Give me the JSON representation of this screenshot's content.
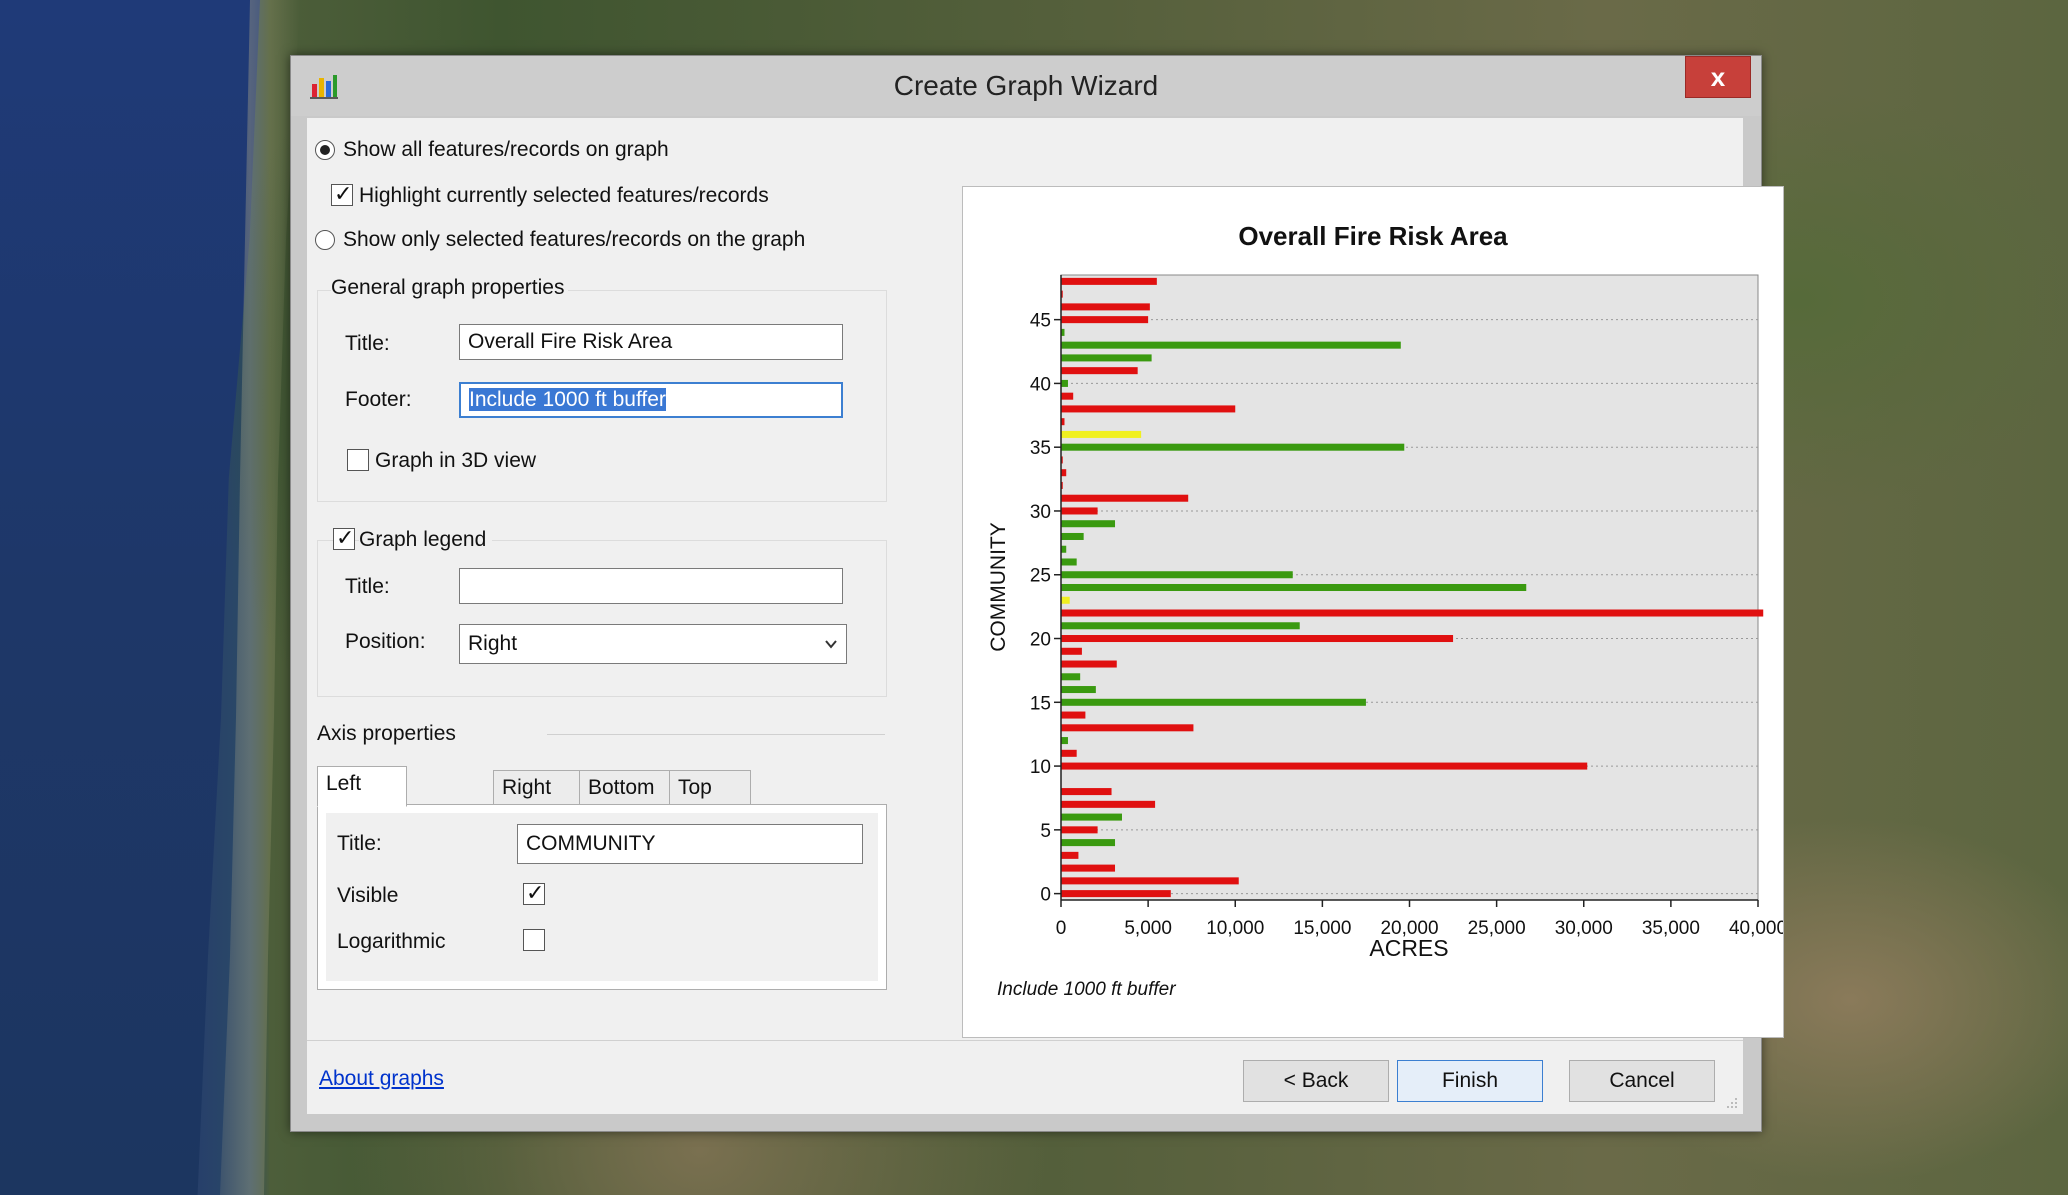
{
  "window": {
    "title": "Create Graph Wizard",
    "close_label": "x"
  },
  "display_options": {
    "show_all_label": "Show all features/records on graph",
    "show_all_selected": true,
    "highlight_label": "Highlight currently selected features/records",
    "highlight_checked": true,
    "show_selected_label": "Show only selected features/records on the graph",
    "show_selected_selected": false
  },
  "general": {
    "group_label": "General graph properties",
    "title_label": "Title:",
    "title_value": "Overall Fire Risk Area",
    "footer_label": "Footer:",
    "footer_value": "Include 1000 ft buffer",
    "view3d_label": "Graph in 3D view",
    "view3d_checked": false
  },
  "legend": {
    "group_label": "Graph legend",
    "checked": true,
    "title_label": "Title:",
    "title_value": "",
    "position_label": "Position:",
    "position_value": "Right"
  },
  "axis": {
    "group_label": "Axis properties",
    "tabs": [
      "Left",
      "Right",
      "Bottom",
      "Top"
    ],
    "active_tab": "Left",
    "title_label": "Title:",
    "title_value": "COMMUNITY",
    "visible_label": "Visible",
    "visible_checked": true,
    "log_label": "Logarithmic",
    "log_checked": false
  },
  "footer_bar": {
    "about_link": "About graphs",
    "back_label": "< Back",
    "finish_label": "Finish",
    "cancel_label": "Cancel"
  },
  "colors": {
    "red": "#e01010",
    "green": "#3a9a10",
    "yellow": "#f0f020",
    "plot_bg": "#e4e4e4"
  },
  "chart_data": {
    "type": "bar",
    "orientation": "horizontal",
    "title": "Overall Fire Risk Area",
    "footer": "Include 1000 ft buffer",
    "xlabel": "ACRES",
    "ylabel": "COMMUNITY",
    "xlim": [
      0,
      40000
    ],
    "ylim": [
      -0.5,
      48.5
    ],
    "xticks": [
      "0",
      "5,000",
      "10,000",
      "15,000",
      "20,000",
      "25,000",
      "30,000",
      "35,000",
      "40,000"
    ],
    "yticks": [
      0,
      5,
      10,
      15,
      20,
      25,
      30,
      35,
      40,
      45
    ],
    "grid": "horizontal dotted",
    "bars": [
      {
        "y": 0,
        "value": 6300,
        "color": "red"
      },
      {
        "y": 1,
        "value": 10200,
        "color": "red"
      },
      {
        "y": 2,
        "value": 3100,
        "color": "red"
      },
      {
        "y": 3,
        "value": 1000,
        "color": "red"
      },
      {
        "y": 4,
        "value": 3100,
        "color": "green"
      },
      {
        "y": 5,
        "value": 2100,
        "color": "red"
      },
      {
        "y": 6,
        "value": 3500,
        "color": "green"
      },
      {
        "y": 7,
        "value": 5400,
        "color": "red"
      },
      {
        "y": 8,
        "value": 2900,
        "color": "red"
      },
      {
        "y": 10,
        "value": 30200,
        "color": "red"
      },
      {
        "y": 11,
        "value": 900,
        "color": "red"
      },
      {
        "y": 12,
        "value": 400,
        "color": "green"
      },
      {
        "y": 13,
        "value": 7600,
        "color": "red"
      },
      {
        "y": 14,
        "value": 1400,
        "color": "red"
      },
      {
        "y": 15,
        "value": 17500,
        "color": "green"
      },
      {
        "y": 16,
        "value": 2000,
        "color": "green"
      },
      {
        "y": 17,
        "value": 1100,
        "color": "green"
      },
      {
        "y": 18,
        "value": 3200,
        "color": "red"
      },
      {
        "y": 19,
        "value": 1200,
        "color": "red"
      },
      {
        "y": 20,
        "value": 22500,
        "color": "red"
      },
      {
        "y": 21,
        "value": 13700,
        "color": "green"
      },
      {
        "y": 22,
        "value": 40300,
        "color": "red"
      },
      {
        "y": 23,
        "value": 500,
        "color": "yellow"
      },
      {
        "y": 24,
        "value": 26700,
        "color": "green"
      },
      {
        "y": 25,
        "value": 13300,
        "color": "green"
      },
      {
        "y": 26,
        "value": 900,
        "color": "green"
      },
      {
        "y": 27,
        "value": 300,
        "color": "green"
      },
      {
        "y": 28,
        "value": 1300,
        "color": "green"
      },
      {
        "y": 29,
        "value": 3100,
        "color": "green"
      },
      {
        "y": 30,
        "value": 2100,
        "color": "red"
      },
      {
        "y": 31,
        "value": 7300,
        "color": "red"
      },
      {
        "y": 32,
        "value": 100,
        "color": "red"
      },
      {
        "y": 33,
        "value": 300,
        "color": "red"
      },
      {
        "y": 34,
        "value": 100,
        "color": "red"
      },
      {
        "y": 35,
        "value": 19700,
        "color": "green"
      },
      {
        "y": 36,
        "value": 4600,
        "color": "yellow"
      },
      {
        "y": 37,
        "value": 200,
        "color": "red"
      },
      {
        "y": 38,
        "value": 10000,
        "color": "red"
      },
      {
        "y": 39,
        "value": 700,
        "color": "red"
      },
      {
        "y": 40,
        "value": 400,
        "color": "green"
      },
      {
        "y": 41,
        "value": 4400,
        "color": "red"
      },
      {
        "y": 42,
        "value": 5200,
        "color": "green"
      },
      {
        "y": 43,
        "value": 19500,
        "color": "green"
      },
      {
        "y": 44,
        "value": 200,
        "color": "green"
      },
      {
        "y": 45,
        "value": 5000,
        "color": "red"
      },
      {
        "y": 46,
        "value": 5100,
        "color": "red"
      },
      {
        "y": 47,
        "value": 100,
        "color": "red"
      },
      {
        "y": 48,
        "value": 5500,
        "color": "red"
      }
    ]
  }
}
